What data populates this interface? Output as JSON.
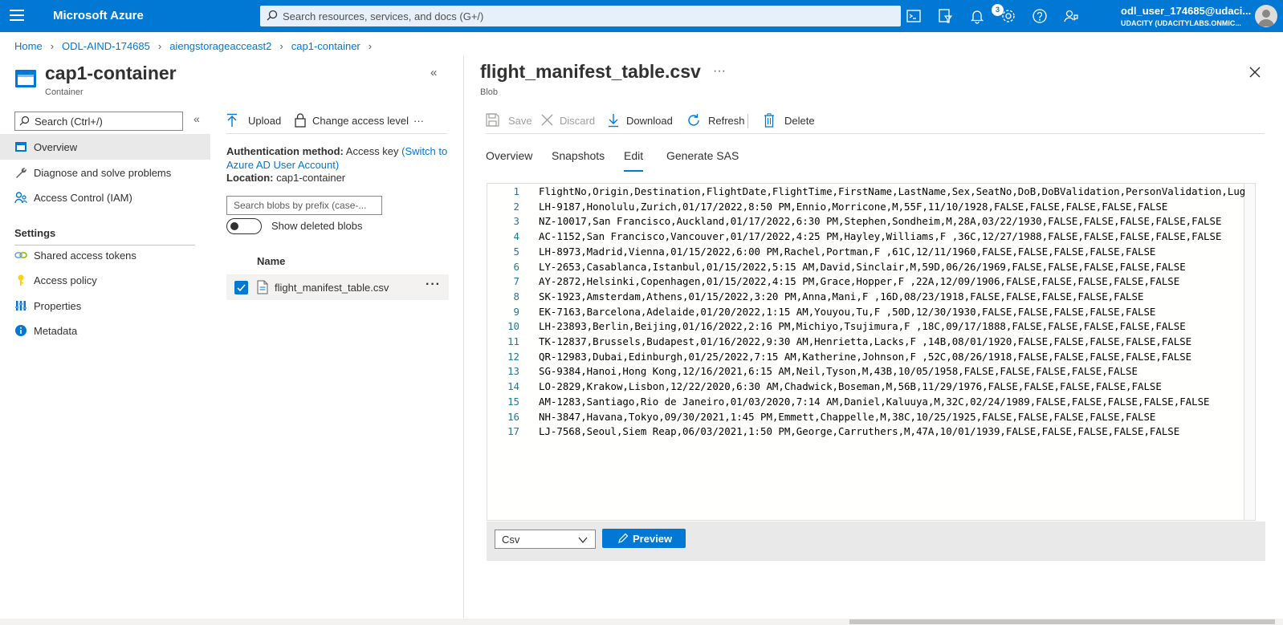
{
  "topbar": {
    "brand": "Microsoft Azure",
    "search_placeholder": "Search resources, services, and docs (G+/)",
    "notification_count": "3",
    "user_name": "odl_user_174685@udaci...",
    "user_org": "UDACITY (UDACITYLABS.ONMIC...",
    "icons": [
      "cloud-shell-icon",
      "directory-filter-icon",
      "bell-icon",
      "gear-icon",
      "help-icon",
      "feedback-icon"
    ]
  },
  "breadcrumb": [
    "Home",
    "ODL-AIND-174685",
    "aiengstorageacceast2",
    "cap1-container"
  ],
  "resource": {
    "title": "cap1-container",
    "subtitle": "Container"
  },
  "nav": {
    "search_placeholder": "Search (Ctrl+/)",
    "items": [
      {
        "label": "Overview",
        "icon": "overview-icon",
        "active": true
      },
      {
        "label": "Diagnose and solve problems",
        "icon": "wrench-icon"
      },
      {
        "label": "Access Control (IAM)",
        "icon": "people-icon"
      }
    ],
    "settings_header": "Settings",
    "settings_items": [
      {
        "label": "Shared access tokens",
        "icon": "link-icon"
      },
      {
        "label": "Access policy",
        "icon": "key-icon"
      },
      {
        "label": "Properties",
        "icon": "properties-icon"
      },
      {
        "label": "Metadata",
        "icon": "info-icon"
      }
    ]
  },
  "list": {
    "toolbar": {
      "upload": "Upload",
      "change_access": "Change access level",
      "more": "···"
    },
    "auth_label": "Authentication method:",
    "auth_value": "Access key",
    "auth_link": "(Switch to Azure AD User Account)",
    "location_label": "Location:",
    "location_value": "cap1-container",
    "blob_search_placeholder": "Search blobs by prefix (case-...",
    "show_deleted": "Show deleted blobs",
    "column_name": "Name",
    "files": [
      {
        "name": "flight_manifest_table.csv",
        "selected": true
      }
    ]
  },
  "blob": {
    "title": "flight_manifest_table.csv",
    "title_more": "···",
    "subtitle": "Blob",
    "toolbar": {
      "save": "Save",
      "discard": "Discard",
      "download": "Download",
      "refresh": "Refresh",
      "delete": "Delete"
    },
    "tabs": [
      "Overview",
      "Snapshots",
      "Edit",
      "Generate SAS"
    ],
    "active_tab": "Edit",
    "lines": [
      "FlightNo,Origin,Destination,FlightDate,FlightTime,FirstName,LastName,Sex,SeatNo,DoB,DoBValidation,PersonValidation,Lug",
      "LH-9187,Honolulu,Zurich,01/17/2022,8:50 PM,Ennio,Morricone,M,55F,11/10/1928,FALSE,FALSE,FALSE,FALSE,FALSE",
      "NZ-10017,San Francisco,Auckland,01/17/2022,6:30 PM,Stephen,Sondheim,M,28A,03/22/1930,FALSE,FALSE,FALSE,FALSE,FALSE",
      "AC-1152,San Francisco,Vancouver,01/17/2022,4:25 PM,Hayley,Williams,F ,36C,12/27/1988,FALSE,FALSE,FALSE,FALSE,FALSE",
      "LH-8973,Madrid,Vienna,01/15/2022,6:00 PM,Rachel,Portman,F ,61C,12/11/1960,FALSE,FALSE,FALSE,FALSE,FALSE",
      "LY-2653,Casablanca,Istanbul,01/15/2022,5:15 AM,David,Sinclair,M,59D,06/26/1969,FALSE,FALSE,FALSE,FALSE,FALSE",
      "AY-2872,Helsinki,Copenhagen,01/15/2022,4:15 PM,Grace,Hopper,F ,22A,12/09/1906,FALSE,FALSE,FALSE,FALSE,FALSE",
      "SK-1923,Amsterdam,Athens,01/15/2022,3:20 PM,Anna,Mani,F ,16D,08/23/1918,FALSE,FALSE,FALSE,FALSE,FALSE",
      "EK-7163,Barcelona,Adelaide,01/20/2022,1:15 AM,Youyou,Tu,F ,50D,12/30/1930,FALSE,FALSE,FALSE,FALSE,FALSE",
      "LH-23893,Berlin,Beijing,01/16/2022,2:16 PM,Michiyo,Tsujimura,F ,18C,09/17/1888,FALSE,FALSE,FALSE,FALSE,FALSE",
      "TK-12837,Brussels,Budapest,01/16/2022,9:30 AM,Henrietta,Lacks,F ,14B,08/01/1920,FALSE,FALSE,FALSE,FALSE,FALSE",
      "QR-12983,Dubai,Edinburgh,01/25/2022,7:15 AM,Katherine,Johnson,F ,52C,08/26/1918,FALSE,FALSE,FALSE,FALSE,FALSE",
      "SG-9384,Hanoi,Hong Kong,12/16/2021,6:15 AM,Neil,Tyson,M,43B,10/05/1958,FALSE,FALSE,FALSE,FALSE,FALSE",
      "LO-2829,Krakow,Lisbon,12/22/2020,6:30 AM,Chadwick,Boseman,M,56B,11/29/1976,FALSE,FALSE,FALSE,FALSE,FALSE",
      "AM-1283,Santiago,Rio de Janeiro,01/03/2020,7:14 AM,Daniel,Kaluuya,M,32C,02/24/1989,FALSE,FALSE,FALSE,FALSE,FALSE",
      "NH-3847,Havana,Tokyo,09/30/2021,1:45 PM,Emmett,Chappelle,M,38C,10/25/1925,FALSE,FALSE,FALSE,FALSE,FALSE",
      "LJ-7568,Seoul,Siem Reap,06/03/2021,1:50 PM,George,Carruthers,M,47A,10/01/1939,FALSE,FALSE,FALSE,FALSE,FALSE"
    ],
    "format_value": "Csv",
    "preview_label": "Preview"
  }
}
